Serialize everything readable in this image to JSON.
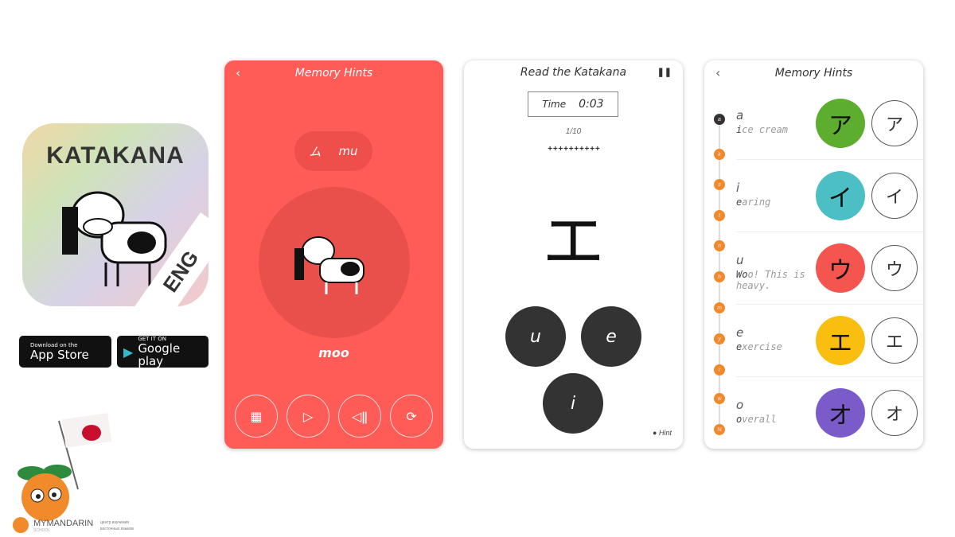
{
  "app_icon": {
    "title": "KATAKANA",
    "badge": "ENG"
  },
  "stores": {
    "apple": {
      "small": "Download on the",
      "big": "App Store"
    },
    "google": {
      "small": "GET IT ON",
      "big": "Google play"
    }
  },
  "brand": {
    "name": "MYMANDARIN",
    "sub": "SCHOOL",
    "tagline1": "центр изучения",
    "tagline2": "восточных языков"
  },
  "screen1": {
    "title": "Memory Hints",
    "pill_kana": "ム",
    "pill_romaji": "mu",
    "word": "moo",
    "accent": "#FF5C57",
    "controls": [
      {
        "icon": "grid-icon",
        "glyph": "▦"
      },
      {
        "icon": "play-icon",
        "glyph": "▷"
      },
      {
        "icon": "sound-icon",
        "glyph": "◁ǁ"
      },
      {
        "icon": "refresh-icon",
        "glyph": "⟳"
      }
    ]
  },
  "screen2": {
    "title": "Read the Katakana",
    "time_label": "Time",
    "time_value": "0:03",
    "progress": "1/10",
    "progress_marks": "+ + + + + + + + + +",
    "character": "エ",
    "answers": [
      "u",
      "e",
      "i"
    ],
    "hint": "● Hint"
  },
  "screen3": {
    "title": "Memory Hints",
    "timeline": [
      "a",
      "k",
      "s",
      "t",
      "n",
      "h",
      "m",
      "y",
      "r",
      "w",
      "N"
    ],
    "rows": [
      {
        "romaji": "a",
        "hint_bold": "i",
        "hint_rest": "ce cream",
        "kana": "ア",
        "color": "#5DAE2E"
      },
      {
        "romaji": "i",
        "hint_bold": "e",
        "hint_rest": "aring",
        "kana": "イ",
        "color": "#4BBFC4"
      },
      {
        "romaji": "u",
        "hint_bold": "Wo",
        "hint_rest": "o! This is heavy.",
        "kana": "ウ",
        "color": "#F5554F"
      },
      {
        "romaji": "e",
        "hint_bold": "e",
        "hint_rest": "xercise",
        "kana": "エ",
        "color": "#F9BE0F"
      },
      {
        "romaji": "o",
        "hint_bold": "o",
        "hint_rest": "verall",
        "kana": "オ",
        "color": "#7B5AC9"
      }
    ]
  }
}
